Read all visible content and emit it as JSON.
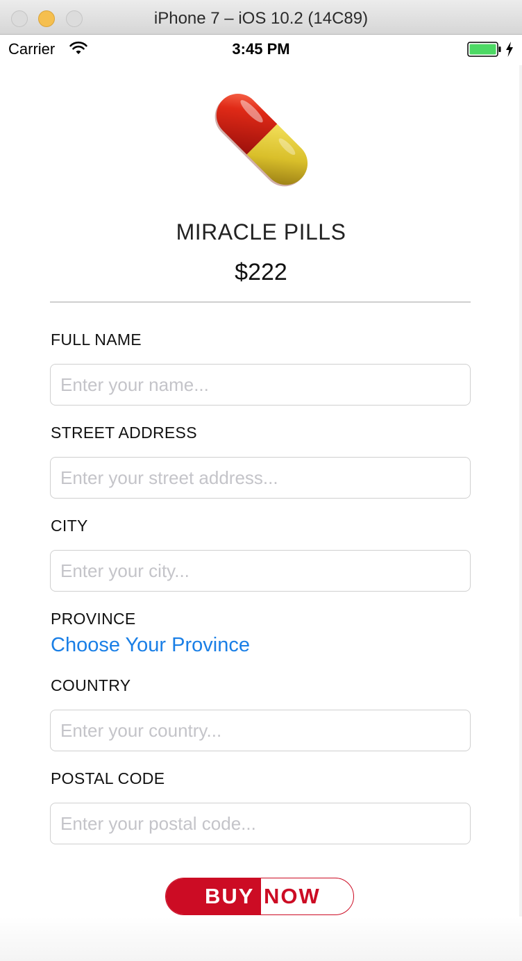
{
  "window": {
    "title": "iPhone 7 – iOS 10.2 (14C89)"
  },
  "status_bar": {
    "carrier": "Carrier",
    "time": "3:45 PM",
    "battery_color": "#4cd964",
    "icons": [
      "wifi-icon",
      "battery-icon",
      "charging-bolt-icon"
    ]
  },
  "product": {
    "icon": "pill-icon",
    "name": "MIRACLE PILLS",
    "price": "$222"
  },
  "form": {
    "full_name": {
      "label": "FULL NAME",
      "placeholder": "Enter your name...",
      "value": ""
    },
    "street_address": {
      "label": "STREET ADDRESS",
      "placeholder": "Enter your street address...",
      "value": ""
    },
    "city": {
      "label": "CITY",
      "placeholder": "Enter your city...",
      "value": ""
    },
    "province": {
      "label": "PROVINCE",
      "link_text": "Choose Your Province"
    },
    "country": {
      "label": "COUNTRY",
      "placeholder": "Enter your country...",
      "value": ""
    },
    "postal_code": {
      "label": "POSTAL CODE",
      "placeholder": "Enter your postal code...",
      "value": ""
    }
  },
  "buy_button": {
    "left_text": "BUY",
    "right_text": "NOW",
    "accent_color": "#cc0c24"
  },
  "colors": {
    "link": "#1a7fe6",
    "placeholder": "#c4c4c9",
    "field_border": "#cfcfcf"
  }
}
